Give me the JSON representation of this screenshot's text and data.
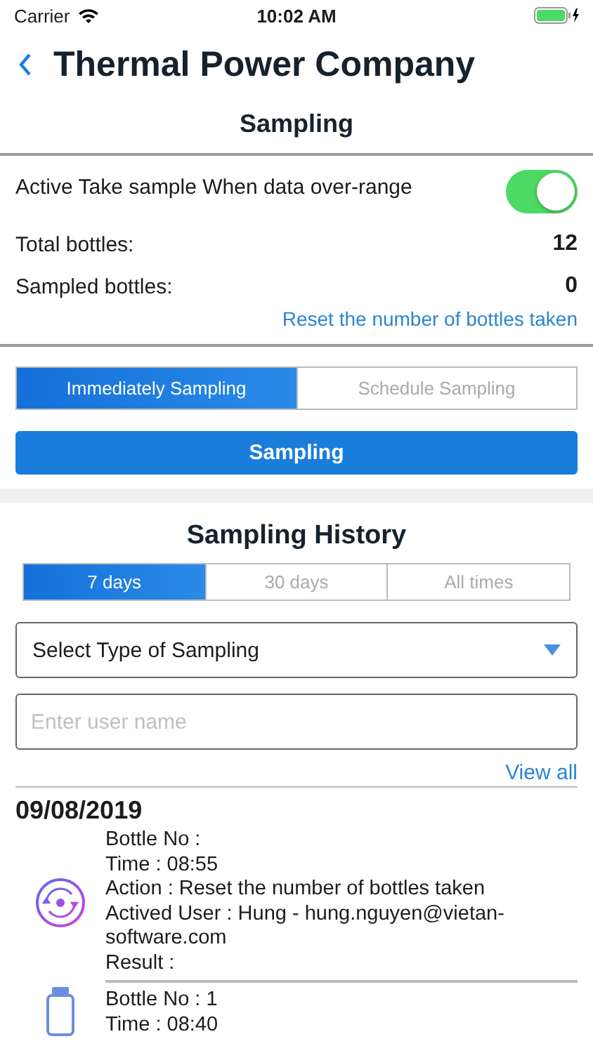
{
  "status_bar": {
    "carrier": "Carrier",
    "time": "10:02 AM"
  },
  "nav": {
    "title": "Thermal Power Company"
  },
  "section_title": "Sampling",
  "auto_sample": {
    "label": "Active Take sample When data over-range",
    "on": true
  },
  "stats": [
    {
      "label": "Total bottles:",
      "value": "12"
    },
    {
      "label": "Sampled bottles:",
      "value": "0"
    }
  ],
  "reset_link": "Reset the number of bottles taken",
  "mode_tabs": [
    {
      "label": "Immediately Sampling",
      "selected": true
    },
    {
      "label": "Schedule Sampling",
      "selected": false
    }
  ],
  "sample_button": "Sampling",
  "history": {
    "title": "Sampling History",
    "period_tabs": [
      {
        "label": "7 days",
        "selected": true
      },
      {
        "label": "30 days",
        "selected": false
      },
      {
        "label": "All times",
        "selected": false
      }
    ],
    "type_select": "Select Type of Sampling",
    "user_field": {
      "placeholder": "Enter user name"
    },
    "view_all": "View all",
    "groups": [
      {
        "date": "09/08/2019",
        "entries": [
          {
            "kind": "reset",
            "lines": [
              "Bottle No :",
              "Time : 08:55",
              "Action : Reset the number of bottles taken",
              "Actived User : Hung - hung.nguyen@vietan-software.com",
              "Result :"
            ]
          },
          {
            "kind": "bottle",
            "lines": [
              "Bottle No : 1",
              "Time : 08:40"
            ]
          }
        ]
      }
    ]
  }
}
